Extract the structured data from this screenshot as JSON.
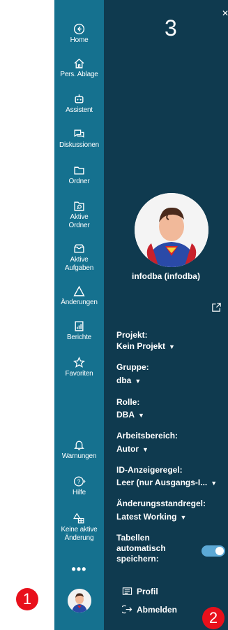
{
  "nav": [
    {
      "label": "Home"
    },
    {
      "label": "Pers. Ablage"
    },
    {
      "label": "Assistent"
    },
    {
      "label": "Diskussionen"
    },
    {
      "label": "Ordner"
    },
    {
      "label": "Aktive\nOrdner"
    },
    {
      "label": "Aktive\nAufgaben"
    },
    {
      "label": "Änderungen"
    },
    {
      "label": "Berichte"
    },
    {
      "label": "Favoriten"
    },
    {
      "label": "Warnungen"
    },
    {
      "label": "Hilfe"
    },
    {
      "label": "Keine aktive\nÄnderung"
    }
  ],
  "more_label": "•••",
  "badges": {
    "one": "1",
    "two": "2",
    "three": "3"
  },
  "user": {
    "name": "infodba (infodba)"
  },
  "fields": {
    "projekt": {
      "label": "Projekt:",
      "value": "Kein Projekt"
    },
    "gruppe": {
      "label": "Gruppe:",
      "value": "dba"
    },
    "rolle": {
      "label": "Rolle:",
      "value": "DBA"
    },
    "arbeitsbereich": {
      "label": "Arbeitsbereich:",
      "value": "Autor"
    },
    "id_anzeigeregel": {
      "label": "ID-Anzeigeregel:",
      "value": "Leer (nur Ausgangs-I..."
    },
    "aenderungsstandregel": {
      "label": "Änderungsstandregel:",
      "value": "Latest Working"
    }
  },
  "autosave": {
    "label": "Tabellen\nautomatisch\nspeichern:",
    "enabled": true
  },
  "actions": {
    "profil": "Profil",
    "abmelden": "Abmelden"
  },
  "colors": {
    "rail": "#15718f",
    "panel": "#0f3a4f",
    "badge": "#e8101b",
    "toggle": "#5ca9d6"
  }
}
